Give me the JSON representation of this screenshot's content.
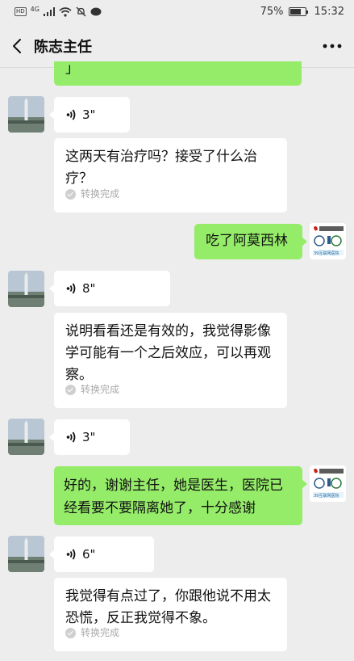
{
  "status_bar": {
    "left_badge": "HD",
    "network": "4G",
    "battery": "75%",
    "battery_level": 0.75,
    "time": "15:32"
  },
  "header": {
    "title": "陈志主任",
    "back_icon": "chevron-left-icon",
    "more_icon": "more-dots-icon"
  },
  "messages": [
    {
      "type": "partial-text",
      "side": "right",
      "text": "」"
    },
    {
      "type": "voice",
      "side": "left",
      "duration": "3\""
    },
    {
      "type": "text",
      "side": "left",
      "text": "这两天有治疗吗？接受了什么治疗？",
      "convert_label": "转换完成"
    },
    {
      "type": "text",
      "side": "right",
      "text": "吃了阿莫西林"
    },
    {
      "type": "voice",
      "side": "left",
      "duration": "8\""
    },
    {
      "type": "text",
      "side": "left",
      "text": "说明看看还是有效的，我觉得影像学可能有一个之后效应，可以再观察。",
      "convert_label": "转换完成"
    },
    {
      "type": "voice",
      "side": "left",
      "duration": "3\""
    },
    {
      "type": "text",
      "side": "right",
      "text": "好的，谢谢主任，她是医生，医院已经看要不要隔离她了，十分感谢"
    },
    {
      "type": "voice",
      "side": "left",
      "duration": "6\""
    },
    {
      "type": "text",
      "side": "left",
      "text": "我觉得有点过了，你跟他说不用太恐慌，反正我觉得不象。",
      "convert_label": "转换完成"
    }
  ],
  "logo_caption": "39互联网医院",
  "colors": {
    "bg": "#ededed",
    "green_bubble": "#95ec69",
    "white_bubble": "#ffffff"
  }
}
